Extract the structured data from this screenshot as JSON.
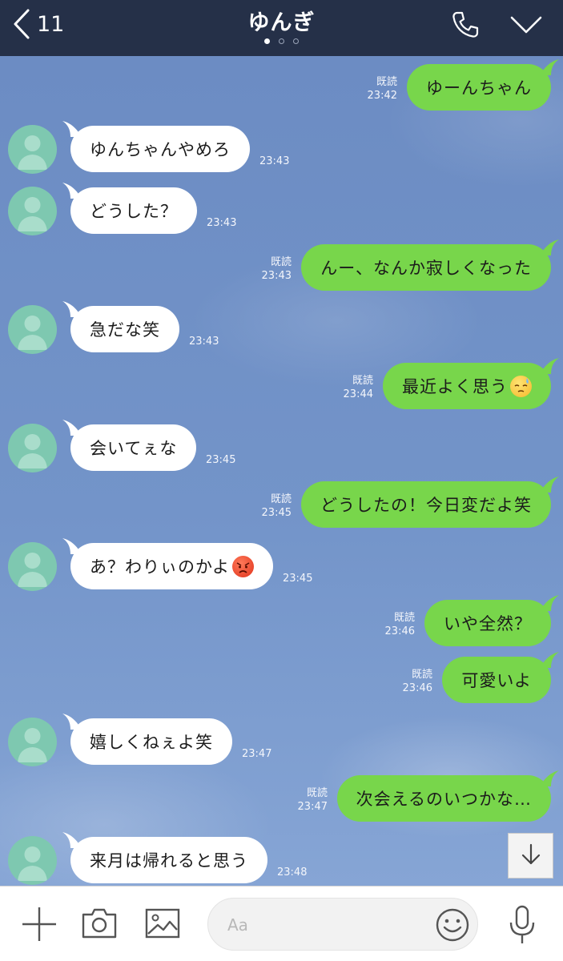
{
  "header": {
    "back_count": "11",
    "title": "ゆんぎ",
    "page_dots": [
      true,
      false,
      false
    ]
  },
  "messages": [
    {
      "side": "out",
      "text": "ゆーんちゃん",
      "read": "既読",
      "time": "23:42"
    },
    {
      "side": "in",
      "text": "ゆんちゃんやめろ",
      "time": "23:43"
    },
    {
      "side": "in",
      "text": "どうした？",
      "time": "23:43"
    },
    {
      "side": "out",
      "text": "んー、なんか寂しくなった",
      "read": "既読",
      "time": "23:43"
    },
    {
      "side": "in",
      "text": "急だな笑",
      "time": "23:43"
    },
    {
      "side": "out",
      "text": "最近よく思う",
      "emoji": "sweat",
      "read": "既読",
      "time": "23:44"
    },
    {
      "side": "in",
      "text": "会いてぇな",
      "time": "23:45"
    },
    {
      "side": "out",
      "text": "どうしたの！今日変だよ笑",
      "read": "既読",
      "time": "23:45"
    },
    {
      "side": "in",
      "text": "あ？わりぃのかよ",
      "emoji": "angry",
      "time": "23:45"
    },
    {
      "side": "out",
      "text": "いや全然？",
      "read": "既読",
      "time": "23:46"
    },
    {
      "side": "out",
      "text": "可愛いよ",
      "read": "既読",
      "time": "23:46"
    },
    {
      "side": "in",
      "text": "嬉しくねぇよ笑",
      "time": "23:47"
    },
    {
      "side": "out",
      "text": "次会えるのいつかな…",
      "read": "既読",
      "time": "23:47"
    },
    {
      "side": "in",
      "text": "来月は帰れると思う",
      "time": "23:48"
    }
  ],
  "footer": {
    "input_placeholder": "Aa"
  },
  "colors": {
    "header_bg": "#253048",
    "outgoing_bubble": "#78d64b",
    "incoming_bubble": "#ffffff",
    "avatar": "#7ec8b0"
  },
  "icons": [
    "chevron-left-icon",
    "phone-icon",
    "chevron-down-icon",
    "arrow-down-icon",
    "plus-icon",
    "camera-icon",
    "image-icon",
    "smiley-icon",
    "microphone-icon"
  ]
}
